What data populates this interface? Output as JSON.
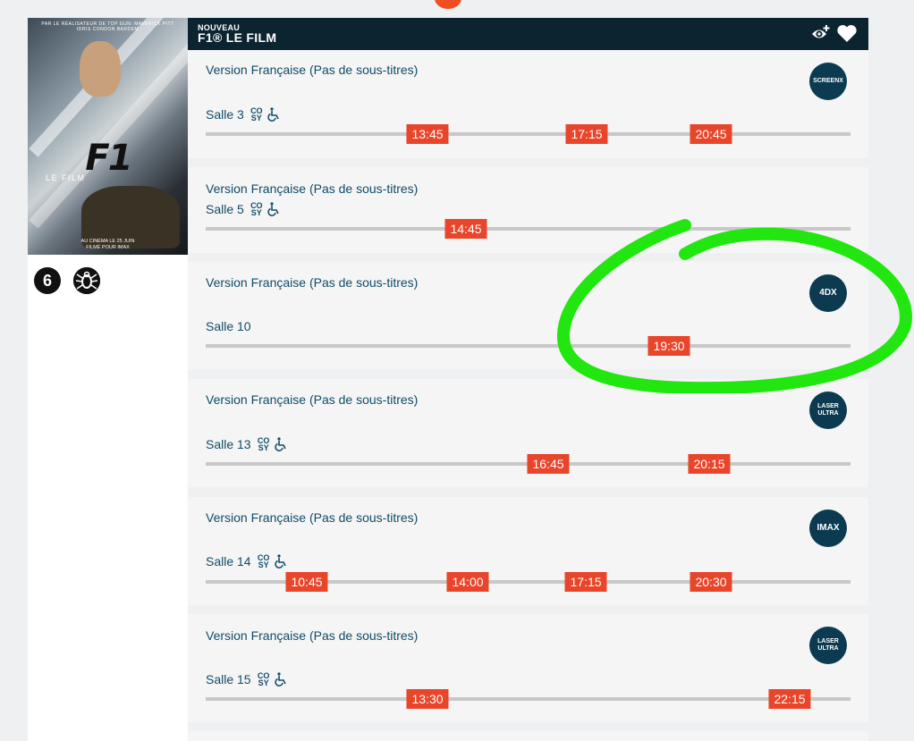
{
  "movie": {
    "tag": "NOUVEAU",
    "title": "F1® LE FILM",
    "rating_badge": "6",
    "content_badge_icon": "spider-icon",
    "poster": {
      "cast_line": "PAR LE RÉALISATEUR DE TOP GUN: MAVERICK   PITT   IDRIS   CONDON   BARDEM",
      "logo_text": "F1",
      "subtitle": "LE FILM",
      "release_line1": "AU CINÉMA LE 25 JUIN",
      "release_line2": "FILMÉ POUR IMAX"
    }
  },
  "header_icons": [
    "eye-add-icon",
    "heart-icon"
  ],
  "showings": [
    {
      "version": "Version Française (Pas de sous-titres)",
      "salle": "Salle 3",
      "accessible": true,
      "format": "SCREENX",
      "times": [
        "13:45",
        "17:15",
        "20:45"
      ]
    },
    {
      "version": "Version Française (Pas de sous-titres)",
      "salle": "Salle 5",
      "accessible": true,
      "format": "",
      "times": [
        "14:45"
      ]
    },
    {
      "version": "Version Française (Pas de sous-titres)",
      "salle": "Salle 10",
      "accessible": false,
      "format": "4DX",
      "times": [
        "19:30"
      ]
    },
    {
      "version": "Version Française (Pas de sous-titres)",
      "salle": "Salle 13",
      "accessible": true,
      "format": "LASER ULTRA",
      "times": [
        "16:45",
        "20:15"
      ]
    },
    {
      "version": "Version Française (Pas de sous-titres)",
      "salle": "Salle 14",
      "accessible": true,
      "format": "IMAX",
      "times": [
        "10:45",
        "14:00",
        "17:15",
        "20:30"
      ]
    },
    {
      "version": "Version Française (Pas de sous-titres)",
      "salle": "Salle 15",
      "accessible": true,
      "format": "LASER ULTRA",
      "times": [
        "13:30",
        "22:15"
      ]
    }
  ],
  "accessibility": {
    "cosy_label": "CO SY",
    "wheelchair_icon": "wheelchair-icon"
  },
  "colors": {
    "header_bg": "#0b2430",
    "time_badge": "#e9452b",
    "text": "#0f4c69",
    "annotation": "#22e60f"
  }
}
